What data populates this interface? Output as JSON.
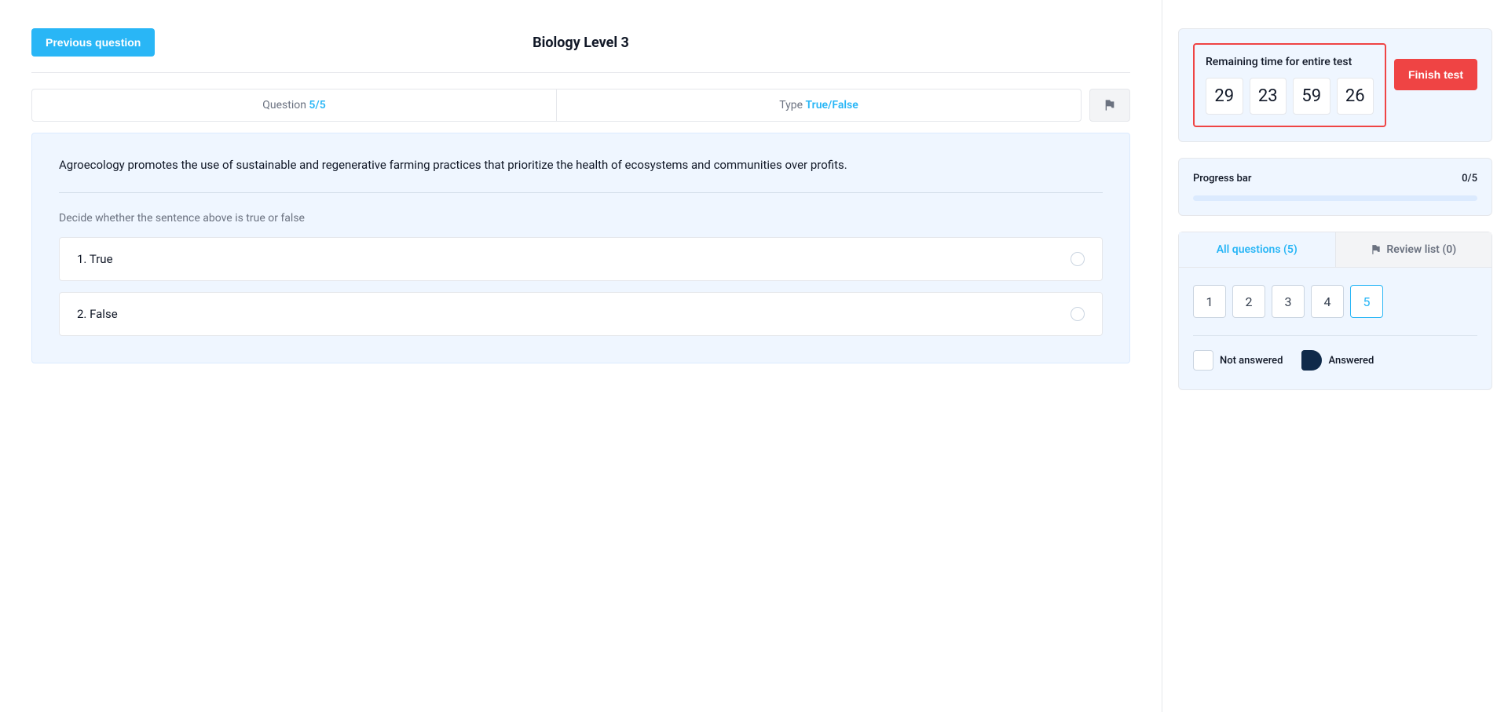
{
  "header": {
    "prev_label": "Previous question",
    "title": "Biology Level 3"
  },
  "meta": {
    "question_label": "Question",
    "question_value": "5/5",
    "type_label": "Type",
    "type_value": "True/False"
  },
  "question": {
    "text": "Agroecology promotes the use of sustainable and regenerative farming practices that prioritize the health of ecosystems and communities over profits.",
    "instruction": "Decide whether the sentence above is true or false",
    "options": [
      {
        "label": "1. True"
      },
      {
        "label": "2. False"
      }
    ]
  },
  "timer": {
    "label": "Remaining time for entire test",
    "days": "29",
    "hours": "23",
    "minutes": "59",
    "seconds": "26",
    "finish_label": "Finish test"
  },
  "progress": {
    "label": "Progress bar",
    "value": "0/5"
  },
  "nav": {
    "tab_all_label": "All questions (5)",
    "tab_review_label": "Review list (0)",
    "questions": [
      "1",
      "2",
      "3",
      "4",
      "5"
    ],
    "active": "5",
    "legend_not_answered": "Not answered",
    "legend_answered": "Answered"
  }
}
